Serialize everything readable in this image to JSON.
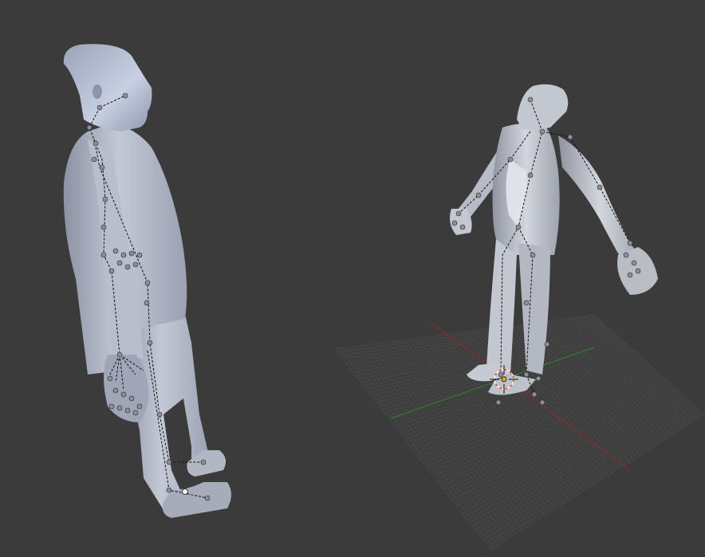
{
  "viewport": {
    "background": "#3b3b3b",
    "mesh_color": "#aeb5c4",
    "grid_line_color": "#4a4a4a",
    "x_axis_color": "#8a2b2b",
    "y_axis_color": "#2f7a2f",
    "bone_color": "#111111",
    "joint_color": "#8d8f94",
    "cursor_color": "#e04a2a"
  },
  "objects": [
    {
      "type": "armature-mesh-figure",
      "pose": "rest",
      "view": "side-profile"
    },
    {
      "type": "armature-mesh-figure",
      "pose": "arms-out-head-back",
      "view": "perspective-on-grid"
    }
  ],
  "icons": [
    "3d-cursor-icon",
    "origin-dot-icon"
  ]
}
